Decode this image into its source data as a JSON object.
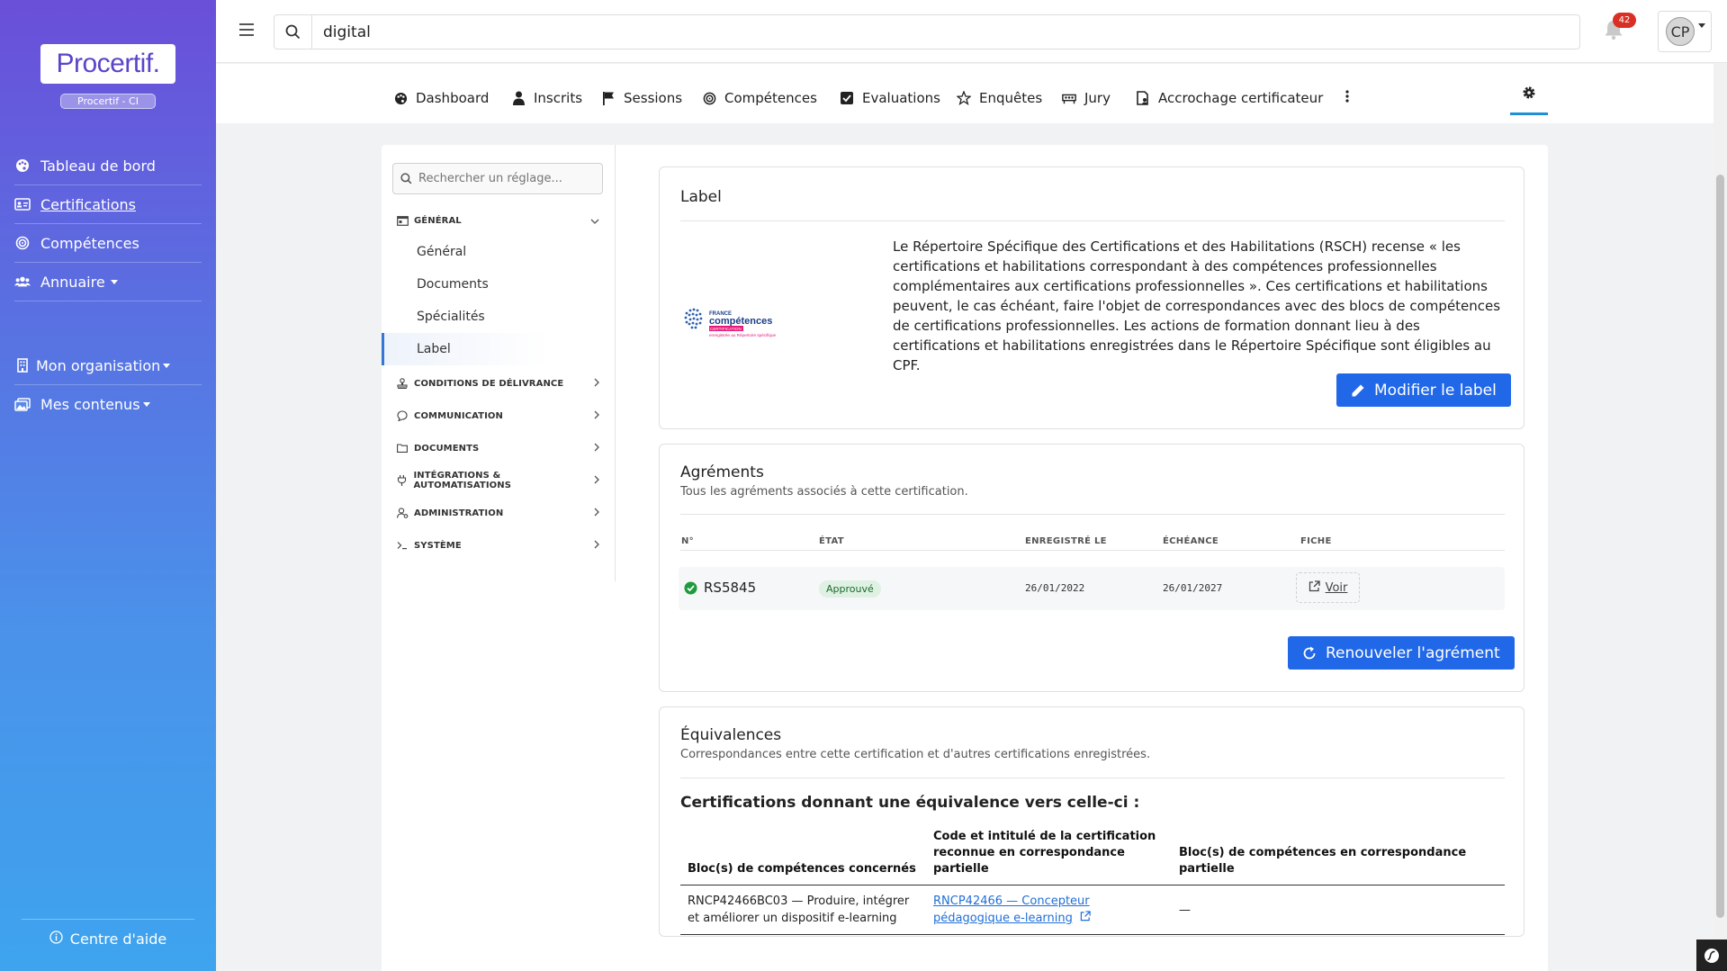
{
  "sidebar": {
    "logo": "Procertif.",
    "org_badge": "Procertif - CI",
    "items": [
      {
        "label": "Tableau de bord",
        "icon": "palette-icon"
      },
      {
        "label": "Certifications",
        "icon": "id-card-icon"
      },
      {
        "label": "Compétences",
        "icon": "target-icon"
      },
      {
        "label": "Annuaire",
        "icon": "users-icon"
      },
      {
        "label": "Mon organisation",
        "icon": "building-icon"
      },
      {
        "label": "Mes contenus",
        "icon": "images-icon"
      }
    ],
    "help": "Centre d'aide"
  },
  "topbar": {
    "search_value": "digital",
    "notifications": "42",
    "avatar_initials": "CP"
  },
  "tabs": [
    {
      "label": "Dashboard",
      "icon": "palette-icon"
    },
    {
      "label": "Inscrits",
      "icon": "user-icon"
    },
    {
      "label": "Sessions",
      "icon": "flag-icon"
    },
    {
      "label": "Compétences",
      "icon": "target-icon"
    },
    {
      "label": "Evaluations",
      "icon": "check-square-icon"
    },
    {
      "label": "Enquêtes",
      "icon": "star-icon"
    },
    {
      "label": "Jury",
      "icon": "jury-icon"
    },
    {
      "label": "Accrochage certificateur",
      "icon": "file-person-icon"
    }
  ],
  "settings_nav": {
    "search_placeholder": "Rechercher un réglage...",
    "sections": [
      {
        "label": "GÉNÉRAL",
        "expanded": true,
        "items": [
          "Général",
          "Documents",
          "Spécialités",
          "Label"
        ]
      },
      {
        "label": "CONDITIONS DE DÉLIVRANCE"
      },
      {
        "label": "COMMUNICATION"
      },
      {
        "label": "DOCUMENTS"
      },
      {
        "label": "INTÉGRATIONS & AUTOMATISATIONS"
      },
      {
        "label": "ADMINISTRATION"
      },
      {
        "label": "SYSTÈME"
      }
    ],
    "active_item": "Label"
  },
  "label_card": {
    "title": "Label",
    "logo_line1": "FRANCE",
    "logo_line2": "compétences",
    "logo_line3": "CERTIFICATION",
    "logo_line4": "enregistrée au Répertoire spécifique",
    "description": "Le Répertoire Spécifique des Certifications et des Habilitations (RSCH) recense « les certifications et habilitations correspondant à des compétences professionnelles complémentaires aux certifications professionnelles ». Ces certifications et habilitations peuvent, le cas échéant, faire l'objet de correspondances avec des blocs de compétences de certifications professionnelles. Les actions de formation donnant lieu à des certifications et habilitations enregistrées dans le Répertoire Spécifique sont éligibles au CPF.",
    "button": "Modifier le label"
  },
  "agrements_card": {
    "title": "Agréments",
    "subtitle": "Tous les agréments associés à cette certification.",
    "columns": [
      "N°",
      "ÉTAT",
      "ENREGISTRÉ LE",
      "ÉCHÉANCE",
      "FICHE"
    ],
    "row": {
      "number": "RS5845",
      "status": "Approuvé",
      "registered": "26/01/2022",
      "expiry": "26/01/2027",
      "link": "Voir"
    },
    "button": "Renouveler l'agrément"
  },
  "equivalences_card": {
    "title": "Équivalences",
    "subtitle": "Correspondances entre cette certification et d'autres certifications enregistrées.",
    "heading": "Certifications donnant une équivalence vers celle-ci :",
    "columns": [
      "Bloc(s) de compétences concernés",
      "Code et intitulé de la certification reconnue en correspondance partielle",
      "Bloc(s) de compétences en correspondance partielle"
    ],
    "rows": [
      {
        "bloc": "RNCP42466BC03 — Produire, intégrer et améliorer un dispositif e-learning",
        "certification": "RNCP42466 — Concepteur pédagogique e-learning",
        "partial": "—"
      }
    ]
  },
  "colors": {
    "accent": "#2168e8",
    "sidebar_top": "#6a4fd9",
    "sidebar_bottom": "#3ea4ee",
    "success": "#1e9b3c",
    "notification": "#d93025"
  }
}
